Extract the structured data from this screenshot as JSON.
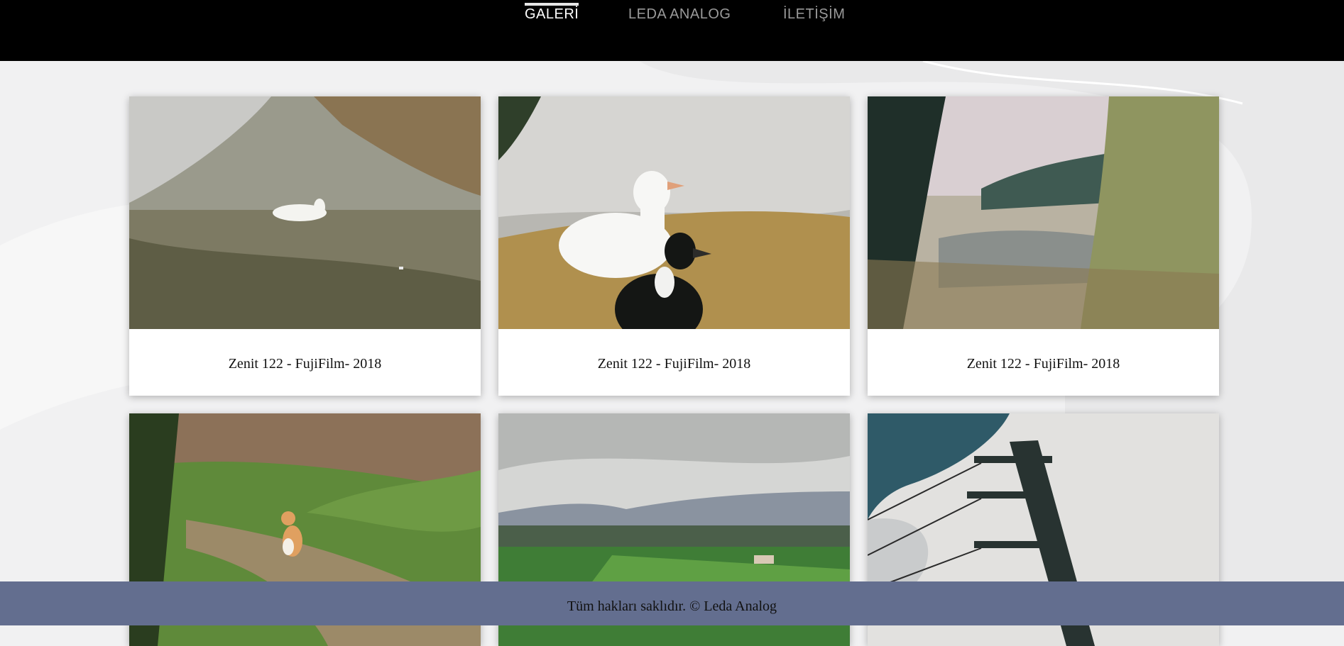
{
  "nav": {
    "items": [
      {
        "label": "GALERİ",
        "active": true
      },
      {
        "label": "LEDA ANALOG",
        "active": false
      },
      {
        "label": "İLETİŞİM",
        "active": false
      }
    ]
  },
  "gallery": {
    "cards": [
      {
        "caption": "Zenit 122 - FujiFilm- 2018",
        "photo": "duck-swimming-pond"
      },
      {
        "caption": "Zenit 122 - FujiFilm- 2018",
        "photo": "white-and-black-ducks"
      },
      {
        "caption": "Zenit 122 - FujiFilm- 2018",
        "photo": "river-landscape"
      },
      {
        "caption": "",
        "photo": "cat-on-path"
      },
      {
        "caption": "",
        "photo": "valley-mountains"
      },
      {
        "caption": "",
        "photo": "power-pole-clouds"
      }
    ]
  },
  "footer": {
    "text": "Tüm hakları saklıdır. © Leda Analog"
  },
  "colors": {
    "header_bg": "#000000",
    "footer_bg": "#636e8f",
    "page_bg": "#f1f1f2"
  }
}
